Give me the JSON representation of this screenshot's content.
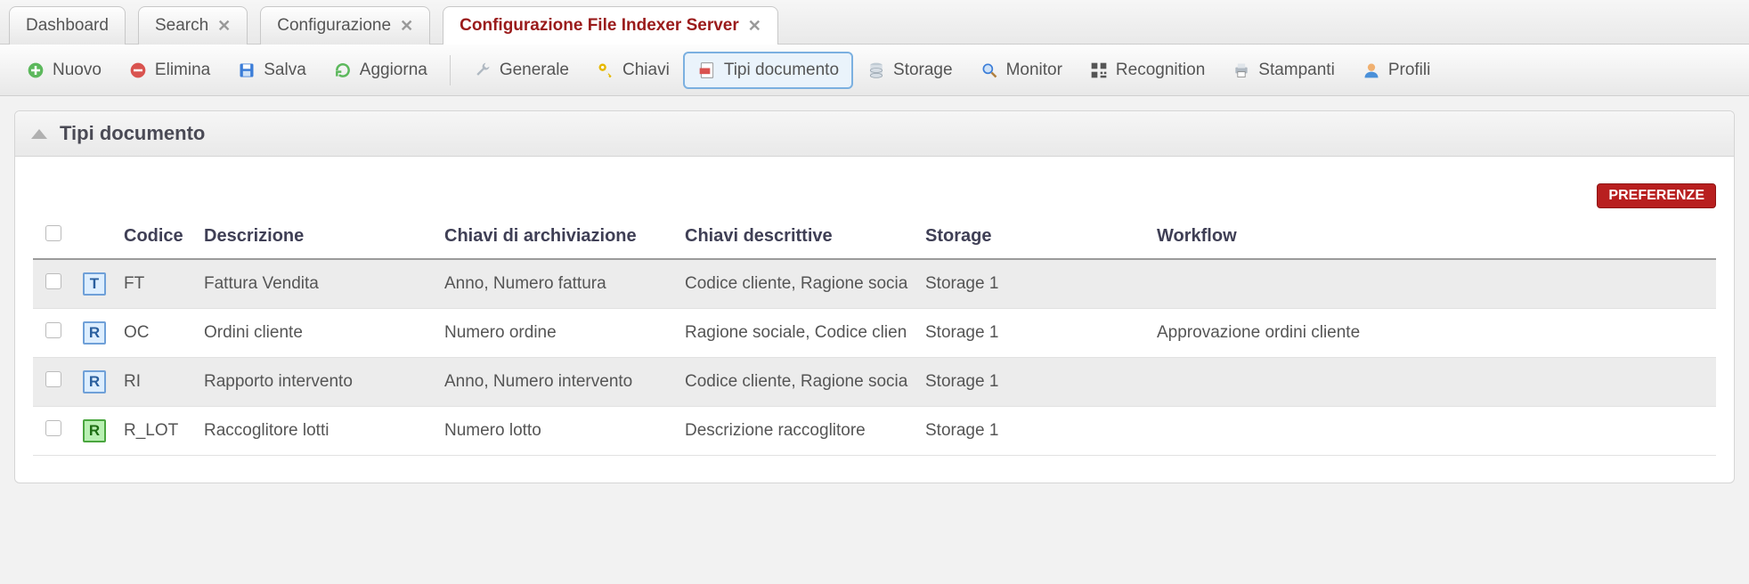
{
  "tabs": [
    {
      "label": "Dashboard",
      "closable": false,
      "active": false
    },
    {
      "label": "Search",
      "closable": true,
      "active": false
    },
    {
      "label": "Configurazione",
      "closable": true,
      "active": false
    },
    {
      "label": "Configurazione File Indexer Server",
      "closable": true,
      "active": true
    }
  ],
  "toolbar": {
    "nuovo": "Nuovo",
    "elimina": "Elimina",
    "salva": "Salva",
    "aggiorna": "Aggiorna",
    "generale": "Generale",
    "chiavi": "Chiavi",
    "tipi_documento": "Tipi documento",
    "storage": "Storage",
    "monitor": "Monitor",
    "recognition": "Recognition",
    "stampanti": "Stampanti",
    "profili": "Profili"
  },
  "panel": {
    "title": "Tipi documento",
    "preferenze_label": "PREFERENZE",
    "columns": {
      "codice": "Codice",
      "descrizione": "Descrizione",
      "chiavi_arch": "Chiavi di archiviazione",
      "chiavi_desc": "Chiavi descrittive",
      "storage": "Storage",
      "workflow": "Workflow"
    },
    "rows": [
      {
        "badge_text": "T",
        "badge_class": "badge-T",
        "codice": "FT",
        "descrizione": "Fattura Vendita",
        "chiavi_arch": "Anno, Numero fattura",
        "chiavi_desc": "Codice cliente, Ragione socia",
        "storage": "Storage 1",
        "workflow": ""
      },
      {
        "badge_text": "R",
        "badge_class": "badge-Rblue",
        "codice": "OC",
        "descrizione": "Ordini cliente",
        "chiavi_arch": "Numero ordine",
        "chiavi_desc": "Ragione sociale, Codice clien",
        "storage": "Storage 1",
        "workflow": "Approvazione ordini cliente"
      },
      {
        "badge_text": "R",
        "badge_class": "badge-Rblue",
        "codice": "RI",
        "descrizione": "Rapporto intervento",
        "chiavi_arch": "Anno, Numero intervento",
        "chiavi_desc": "Codice cliente, Ragione socia",
        "storage": "Storage 1",
        "workflow": ""
      },
      {
        "badge_text": "R",
        "badge_class": "badge-Rgreen",
        "codice": "R_LOT",
        "descrizione": "Raccoglitore lotti",
        "chiavi_arch": "Numero lotto",
        "chiavi_desc": "Descrizione raccoglitore",
        "storage": "Storage 1",
        "workflow": ""
      }
    ]
  }
}
